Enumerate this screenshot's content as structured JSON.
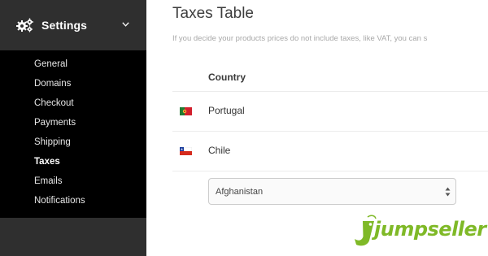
{
  "sidebar": {
    "title": "Settings",
    "icon": "gears-icon",
    "items": [
      {
        "label": "General",
        "active": false
      },
      {
        "label": "Domains",
        "active": false
      },
      {
        "label": "Checkout",
        "active": false
      },
      {
        "label": "Payments",
        "active": false
      },
      {
        "label": "Shipping",
        "active": false
      },
      {
        "label": "Taxes",
        "active": true
      },
      {
        "label": "Emails",
        "active": false
      },
      {
        "label": "Notifications",
        "active": false
      }
    ]
  },
  "main": {
    "title": "Taxes Table",
    "description": "If you decide your products prices do not include taxes, like VAT, you can s",
    "table": {
      "header": "Country",
      "rows": [
        {
          "country": "Portugal",
          "flag": "portugal-flag-icon"
        },
        {
          "country": "Chile",
          "flag": "chile-flag-icon"
        }
      ],
      "select_value": "Afghanistan"
    }
  },
  "logo": {
    "text": "jumpseller",
    "color": "#7fb927"
  }
}
